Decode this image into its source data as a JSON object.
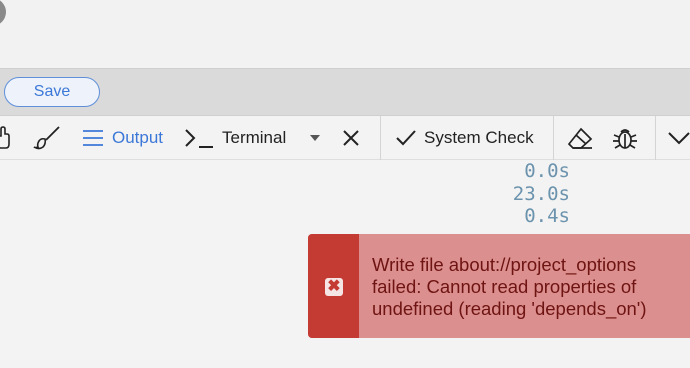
{
  "save_bar": {
    "save_label": "Save"
  },
  "toolbar": {
    "output_label": "Output",
    "terminal_label": "Terminal",
    "system_check_label": "System Check"
  },
  "timings": [
    "0.0s",
    "23.0s",
    "0.4s"
  ],
  "toast": {
    "message": "Write file about://project_options failed: Cannot read properties of undefined (reading 'depends_on')"
  },
  "colors": {
    "accent": "#3c78d8",
    "toast_bg": "#dc8f8f",
    "toast_side": "#c43b34",
    "timing_text": "#6c93ad"
  }
}
